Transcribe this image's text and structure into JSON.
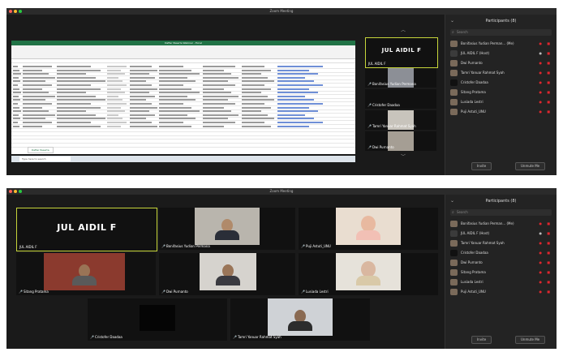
{
  "shot1": {
    "window_title": "Zoom Meeting",
    "excel_title": "Daftar Peserta Webinar - Excel",
    "sheet_tab": "Daftar Peserta",
    "taskbar_search": "Type here to search",
    "sidebar_tiles": [
      {
        "big": "JUL AIDIL F",
        "name": "JUL AIDIL F"
      },
      {
        "name": "Bonifasius Yudian Permana"
      },
      {
        "name": "Cristofer Daadaa"
      },
      {
        "name": "Tamri Yanuar Rahmat Syah"
      },
      {
        "name": "Dwi Purnanto"
      }
    ]
  },
  "shot2": {
    "window_title": "Zoom Meeting",
    "tiles": [
      {
        "big": "JUL AIDIL F",
        "name": "JUL AIDIL F"
      },
      {
        "name": "Bonifasius Yudian Permana"
      },
      {
        "name": "Puji Astuti_UNU"
      },
      {
        "name": "Sitang Pratama"
      },
      {
        "name": "Dwi Purnanto"
      },
      {
        "name": "Lusiada Lestri"
      },
      {
        "name": "Cristofer Daadaa"
      },
      {
        "name": "Tamri Yanuar Rahmat Syah"
      }
    ]
  },
  "participants_panel": {
    "title": "Participants (8)",
    "search_placeholder": "Search",
    "invite_label": "Invite",
    "unmute_all_label": "Unmute Me",
    "participants": [
      {
        "name": "Bonifasius Yudian Perman... (Me)"
      },
      {
        "name": "JUL AIDIL F (Host)"
      },
      {
        "name": "Dwi Purnanto"
      },
      {
        "name": "Tamri Yanuar Rahmat Syah"
      },
      {
        "name": "Cristofer Daadaa"
      },
      {
        "name": "Sitang Pratama"
      },
      {
        "name": "Lusiada Lestri"
      },
      {
        "name": "Puji Astuti_UNU"
      }
    ]
  },
  "colors": {
    "mute_red": "#e0262e",
    "highlight": "#c7d63a",
    "excel_green": "#217346"
  }
}
